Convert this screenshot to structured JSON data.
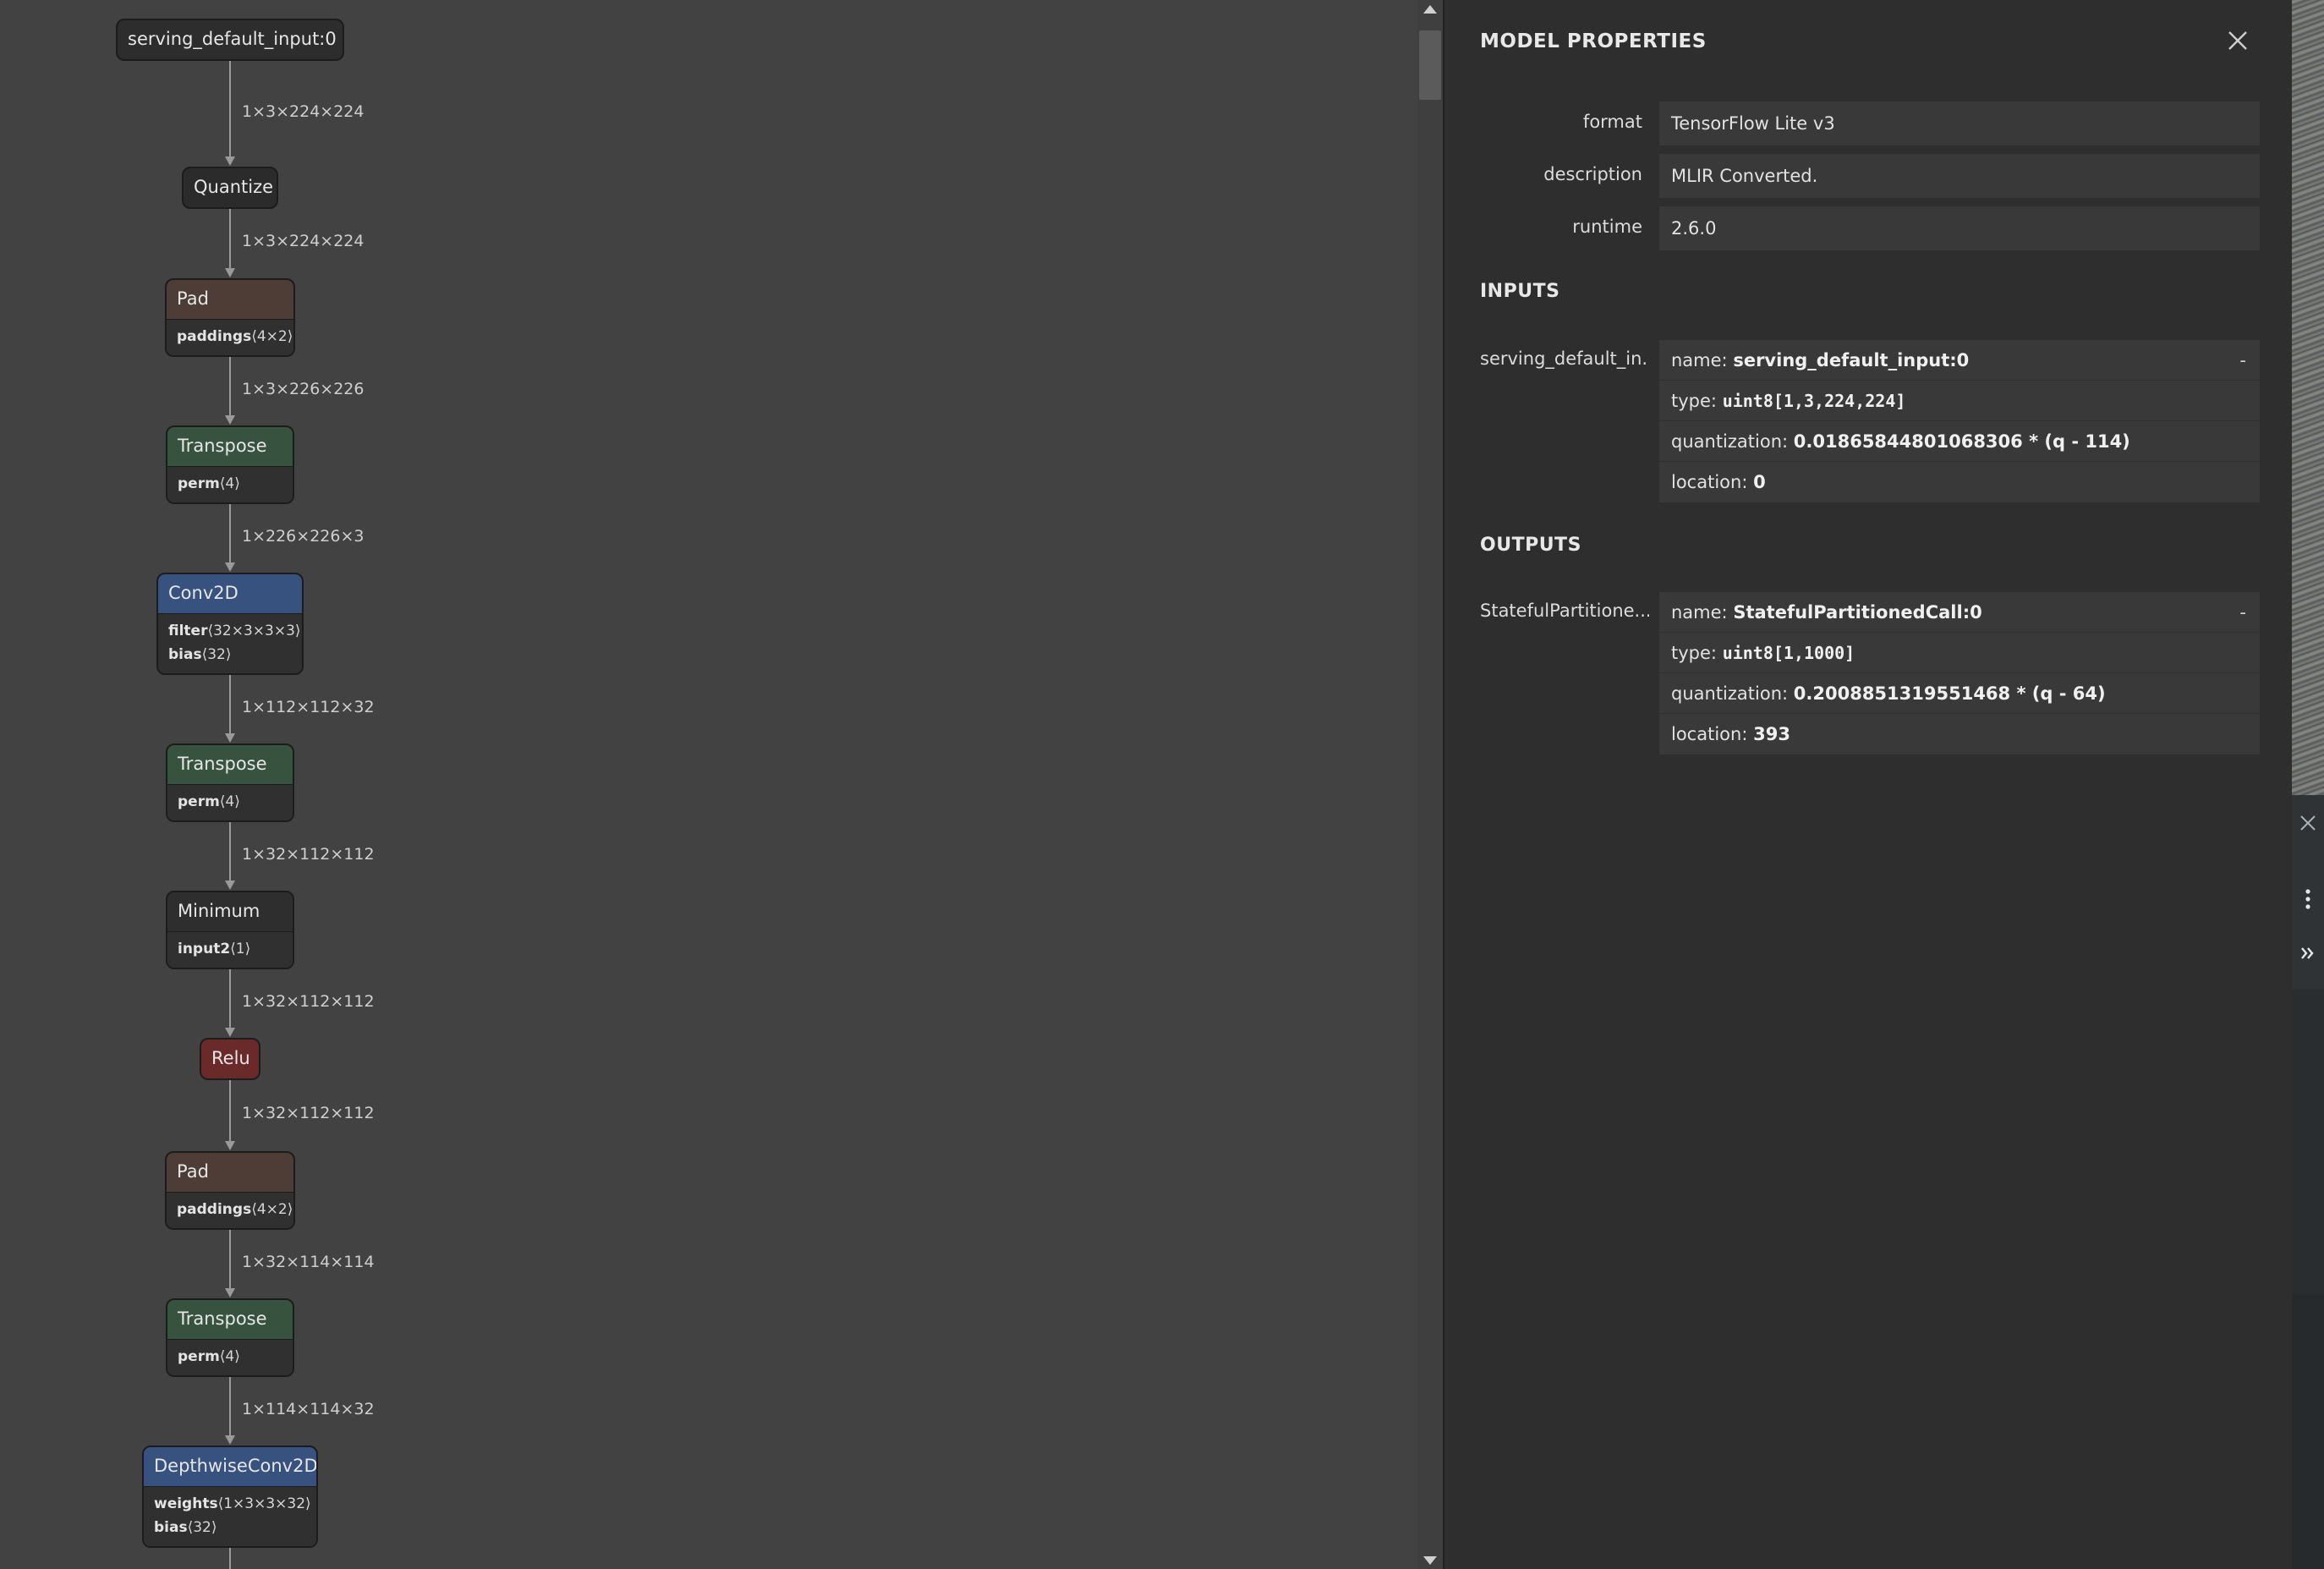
{
  "graph": {
    "nodes": [
      {
        "id": "input",
        "label": "serving_default_input:0 0",
        "style": "io",
        "attrs": []
      },
      {
        "id": "quantize",
        "label": "Quantize",
        "style": "quant",
        "attrs": []
      },
      {
        "id": "pad1",
        "label": "Pad",
        "style": "pad",
        "attrs": [
          {
            "name": "paddings",
            "value": "⟨4×2⟩"
          }
        ]
      },
      {
        "id": "transpose1",
        "label": "Transpose",
        "style": "trans",
        "attrs": [
          {
            "name": "perm",
            "value": "⟨4⟩"
          }
        ]
      },
      {
        "id": "conv2d",
        "label": "Conv2D",
        "style": "conv",
        "attrs": [
          {
            "name": "filter",
            "value": "⟨32×3×3×3⟩"
          },
          {
            "name": "bias",
            "value": "⟨32⟩"
          }
        ]
      },
      {
        "id": "transpose2",
        "label": "Transpose",
        "style": "trans",
        "attrs": [
          {
            "name": "perm",
            "value": "⟨4⟩"
          }
        ]
      },
      {
        "id": "minimum",
        "label": "Minimum",
        "style": "min",
        "attrs": [
          {
            "name": "input2",
            "value": "⟨1⟩"
          }
        ]
      },
      {
        "id": "relu",
        "label": "Relu",
        "style": "relu",
        "attrs": []
      },
      {
        "id": "pad2",
        "label": "Pad",
        "style": "pad",
        "attrs": [
          {
            "name": "paddings",
            "value": "⟨4×2⟩"
          }
        ]
      },
      {
        "id": "transpose3",
        "label": "Transpose",
        "style": "trans",
        "attrs": [
          {
            "name": "perm",
            "value": "⟨4⟩"
          }
        ]
      },
      {
        "id": "dwconv",
        "label": "DepthwiseConv2D",
        "style": "conv",
        "attrs": [
          {
            "name": "weights",
            "value": "⟨1×3×3×32⟩"
          },
          {
            "name": "bias",
            "value": "⟨32⟩"
          }
        ]
      }
    ],
    "edges": [
      "1×3×224×224",
      "1×3×224×224",
      "1×3×226×226",
      "1×226×226×3",
      "1×112×112×32",
      "1×32×112×112",
      "1×32×112×112",
      "1×32×112×112",
      "1×32×114×114",
      "1×114×114×32"
    ]
  },
  "panel": {
    "title": "MODEL PROPERTIES",
    "properties": [
      {
        "label": "format",
        "value": "TensorFlow Lite v3"
      },
      {
        "label": "description",
        "value": "MLIR Converted."
      },
      {
        "label": "runtime",
        "value": "2.6.0"
      }
    ],
    "inputs_title": "INPUTS",
    "outputs_title": "OUTPUTS",
    "inputs": [
      {
        "label": "serving_default_in...",
        "name": "serving_default_input:0",
        "type": "uint8[1,3,224,224]",
        "quantization": "0.01865844801068306 * (q - 114)",
        "location": "0",
        "toggle": "-"
      }
    ],
    "outputs": [
      {
        "label": "StatefulPartitione...",
        "name": "StatefulPartitionedCall:0",
        "type": "uint8[1,1000]",
        "quantization": "0.2008851319551468 * (q - 64)",
        "location": "393",
        "toggle": "-"
      }
    ],
    "field_labels": {
      "name": "name:",
      "type": "type:",
      "quantization": "quantization:",
      "location": "location:"
    }
  },
  "colors": {
    "graph_bg": "#424242",
    "panel_bg": "#2e2e2e",
    "value_bg": "#393939",
    "pad": "#4d3d36",
    "transpose": "#37523f",
    "conv": "#38527f",
    "relu": "#6a2a2a"
  },
  "icons": {
    "close": "close-icon",
    "more": "more-vertical-icon",
    "expand": "double-chevron-right-icon"
  }
}
